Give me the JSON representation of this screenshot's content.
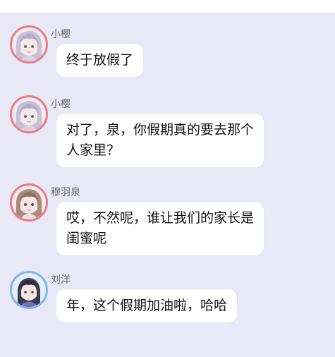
{
  "chat": {
    "messages": [
      {
        "sender": "小樱",
        "lines": [
          "终于放假了"
        ],
        "avatar": "anime-girl-lilac-hair-avatar"
      },
      {
        "sender": "小樱",
        "lines": [
          "对了，泉，你假期真的要去那个",
          "人家里？"
        ],
        "avatar": "anime-girl-lilac-hair-avatar"
      },
      {
        "sender": "穆羽泉",
        "lines": [
          "哎，不然呢，谁让我们的家长是",
          "闺蜜呢"
        ],
        "avatar": "anime-girl-brown-hair-avatar"
      },
      {
        "sender": "刘洋",
        "lines": [
          "年，这个假期加油啦，哈哈"
        ],
        "avatar": "anime-boy-dark-hair-avatar"
      }
    ]
  },
  "colors": {
    "chat_background": "#e8e8f6",
    "bubble_background": "#ffffff",
    "avatar_ring_pink": "#ea7a86",
    "avatar_ring_blue": "#79b8ea",
    "sender_text": "#6a6a6a"
  }
}
